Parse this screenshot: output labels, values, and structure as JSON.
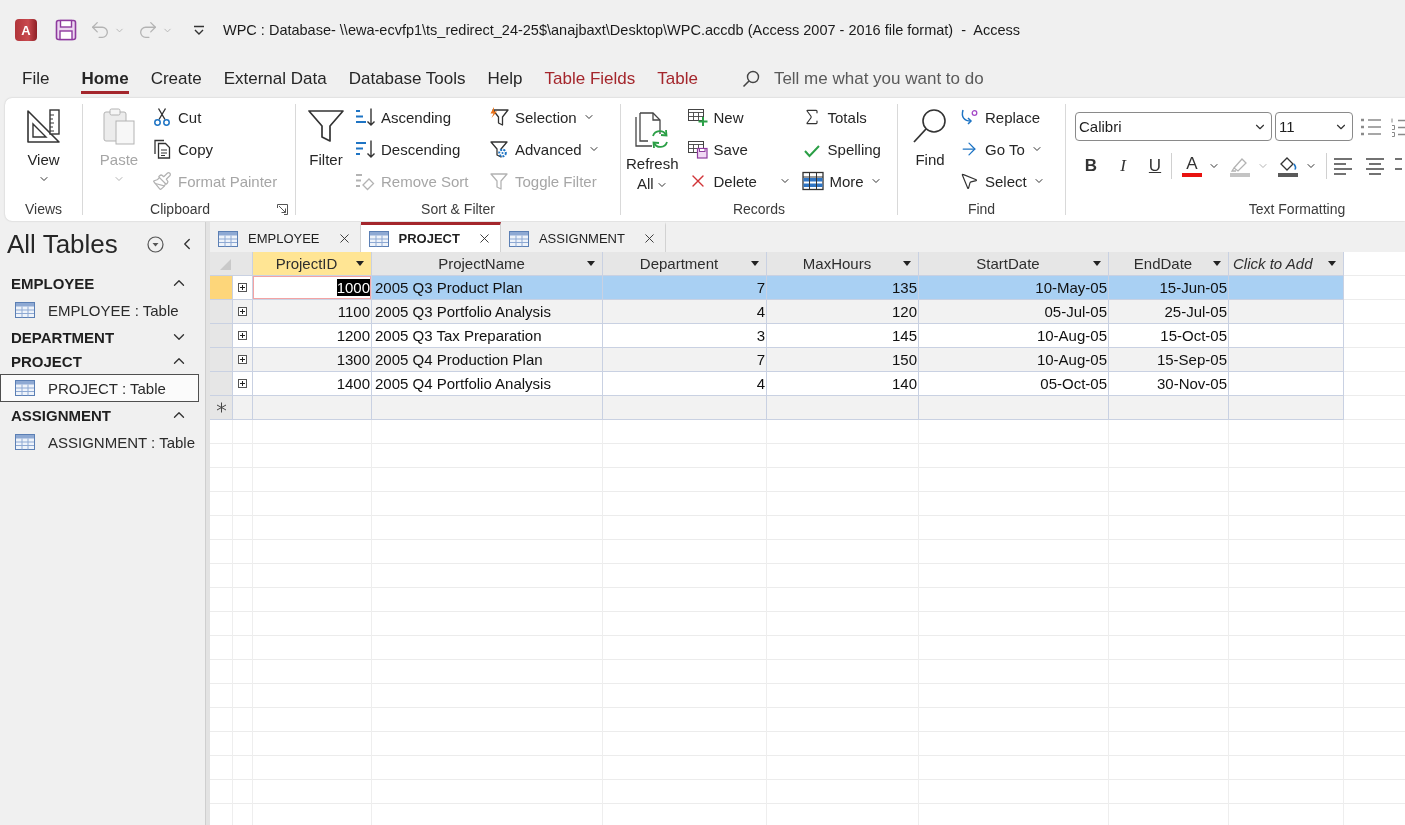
{
  "title_bar": {
    "app_logo": "A",
    "quick_access": [
      {
        "kind": "save",
        "disabled": false,
        "dropdown": false
      },
      {
        "kind": "undo",
        "disabled": true,
        "dropdown": true
      },
      {
        "kind": "redo",
        "disabled": true,
        "dropdown": true
      },
      {
        "kind": "customize",
        "disabled": false,
        "dropdown": false
      }
    ],
    "title": "WPC : Database- \\\\ewa-ecvfp1\\ts_redirect_24-25$\\anajbaxt\\Desktop\\WPC.accdb (Access 2007 - 2016 file format)  -  Access"
  },
  "menu": {
    "tabs": [
      {
        "label": "File",
        "kind": "standard",
        "selected": false
      },
      {
        "label": "Home",
        "kind": "standard",
        "selected": true
      },
      {
        "label": "Create",
        "kind": "standard",
        "selected": false
      },
      {
        "label": "External Data",
        "kind": "standard",
        "selected": false
      },
      {
        "label": "Database Tools",
        "kind": "standard",
        "selected": false
      },
      {
        "label": "Help",
        "kind": "standard",
        "selected": false
      },
      {
        "label": "Table Fields",
        "kind": "contextual",
        "selected": false
      },
      {
        "label": "Table",
        "kind": "contextual",
        "selected": false
      }
    ],
    "search": {
      "placeholder": "Tell me what you want to do"
    }
  },
  "ribbon": {
    "groups": [
      {
        "title": "Views",
        "launcher": false,
        "buttons": [
          {
            "label": "View",
            "kind": "large",
            "disabled": false,
            "dropdown": true
          }
        ]
      },
      {
        "title": "Clipboard",
        "launcher": true,
        "buttons": [
          {
            "label": "Paste",
            "kind": "large",
            "disabled": true,
            "dropdown": true
          },
          {
            "label": "Cut",
            "kind": "small",
            "disabled": false,
            "dropdown": false
          },
          {
            "label": "Copy",
            "kind": "small",
            "disabled": false,
            "dropdown": false
          },
          {
            "label": "Format Painter",
            "kind": "small",
            "disabled": true,
            "dropdown": false
          }
        ]
      },
      {
        "title": "Sort & Filter",
        "launcher": false,
        "buttons": [
          {
            "label": "Filter",
            "kind": "large",
            "disabled": false,
            "dropdown": false
          },
          {
            "label": "Ascending",
            "kind": "small",
            "disabled": false,
            "dropdown": false
          },
          {
            "label": "Descending",
            "kind": "small",
            "disabled": false,
            "dropdown": false
          },
          {
            "label": "Remove Sort",
            "kind": "small",
            "disabled": true,
            "dropdown": false
          },
          {
            "label": "Selection",
            "kind": "small",
            "disabled": false,
            "dropdown": true
          },
          {
            "label": "Advanced",
            "kind": "small",
            "disabled": false,
            "dropdown": true
          },
          {
            "label": "Toggle Filter",
            "kind": "small",
            "disabled": true,
            "dropdown": false
          }
        ]
      },
      {
        "title": "Records",
        "launcher": false,
        "buttons": [
          {
            "label": "Refresh All",
            "kind": "stacked",
            "disabled": false,
            "dropdown": true
          },
          {
            "label": "New",
            "kind": "small",
            "disabled": false,
            "dropdown": false
          },
          {
            "label": "Save",
            "kind": "small",
            "disabled": false,
            "dropdown": false
          },
          {
            "label": "Delete",
            "kind": "split",
            "disabled": false,
            "dropdown": true
          },
          {
            "label": "Totals",
            "kind": "small",
            "disabled": false,
            "dropdown": false
          },
          {
            "label": "Spelling",
            "kind": "small",
            "disabled": false,
            "dropdown": false
          },
          {
            "label": "More",
            "kind": "small",
            "disabled": false,
            "dropdown": true
          }
        ]
      },
      {
        "title": "Find",
        "launcher": false,
        "buttons": [
          {
            "label": "Find",
            "kind": "large",
            "disabled": false,
            "dropdown": false
          },
          {
            "label": "Replace",
            "kind": "small",
            "disabled": false,
            "dropdown": false
          },
          {
            "label": "Go To",
            "kind": "small",
            "disabled": false,
            "dropdown": true
          },
          {
            "label": "Select",
            "kind": "small",
            "disabled": false,
            "dropdown": true
          }
        ]
      }
    ],
    "text_formatting": {
      "title": "Text Formatting",
      "font": {
        "value": "Calibri"
      },
      "size": {
        "value": "11"
      },
      "buttons": [
        {
          "kind": "bold",
          "label": "B",
          "disabled": false,
          "dropdown": false
        },
        {
          "kind": "italic",
          "label": "I",
          "disabled": false,
          "dropdown": false
        },
        {
          "kind": "underline",
          "label": "U",
          "disabled": false,
          "dropdown": false
        },
        {
          "kind": "font_color",
          "label": "A",
          "disabled": false,
          "dropdown": true
        },
        {
          "kind": "highlight",
          "disabled": true,
          "dropdown": true
        },
        {
          "kind": "fill",
          "disabled": false,
          "dropdown": true
        },
        {
          "kind": "align_left",
          "disabled": false,
          "dropdown": false
        },
        {
          "kind": "align_center",
          "disabled": false,
          "dropdown": false
        },
        {
          "kind": "align_right",
          "disabled": false,
          "dropdown": false
        }
      ]
    }
  },
  "navigation": {
    "title": "All Tables",
    "groups": [
      {
        "name": "EMPLOYEE",
        "expanded": true,
        "items": [
          {
            "label": "EMPLOYEE : Table",
            "selected": false
          }
        ]
      },
      {
        "name": "DEPARTMENT",
        "expanded": false
      },
      {
        "name": "PROJECT",
        "expanded": true,
        "items": [
          {
            "label": "PROJECT : Table",
            "selected": true
          }
        ]
      },
      {
        "name": "ASSIGNMENT",
        "expanded": true,
        "items": [
          {
            "label": "ASSIGNMENT : Table",
            "selected": false
          }
        ]
      }
    ]
  },
  "document_tabs": [
    {
      "label": "EMPLOYEE",
      "selected": false
    },
    {
      "label": "PROJECT",
      "selected": true
    },
    {
      "label": "ASSIGNMENT",
      "selected": false
    }
  ],
  "datasheet": {
    "columns": [
      {
        "label": "ProjectID",
        "kind": "number",
        "selected": true
      },
      {
        "label": "ProjectName",
        "kind": "text",
        "selected": false
      },
      {
        "label": "Department",
        "kind": "number",
        "selected": false
      },
      {
        "label": "MaxHours",
        "kind": "number",
        "selected": false
      },
      {
        "label": "StartDate",
        "kind": "date",
        "selected": false
      },
      {
        "label": "EndDate",
        "kind": "date",
        "selected": false
      },
      {
        "label": "Click to Add",
        "kind": "add",
        "selected": false
      }
    ],
    "rows": [
      {
        "selected": true,
        "expanded": false,
        "cells": [
          "1000",
          "2005 Q3 Product Plan",
          "7",
          "135",
          "10-May-05",
          "15-Jun-05"
        ]
      },
      {
        "selected": false,
        "expanded": false,
        "cells": [
          "1100",
          "2005 Q3 Portfolio Analysis",
          "4",
          "120",
          "05-Jul-05",
          "25-Jul-05"
        ]
      },
      {
        "selected": false,
        "expanded": false,
        "cells": [
          "1200",
          "2005 Q3 Tax Preparation",
          "3",
          "145",
          "10-Aug-05",
          "15-Oct-05"
        ]
      },
      {
        "selected": false,
        "expanded": false,
        "cells": [
          "1300",
          "2005 Q4 Production Plan",
          "7",
          "150",
          "10-Aug-05",
          "15-Sep-05"
        ]
      },
      {
        "selected": false,
        "expanded": false,
        "cells": [
          "1400",
          "2005 Q4 Portfolio Analysis",
          "4",
          "140",
          "05-Oct-05",
          "30-Nov-05"
        ]
      }
    ],
    "new_row": true
  }
}
